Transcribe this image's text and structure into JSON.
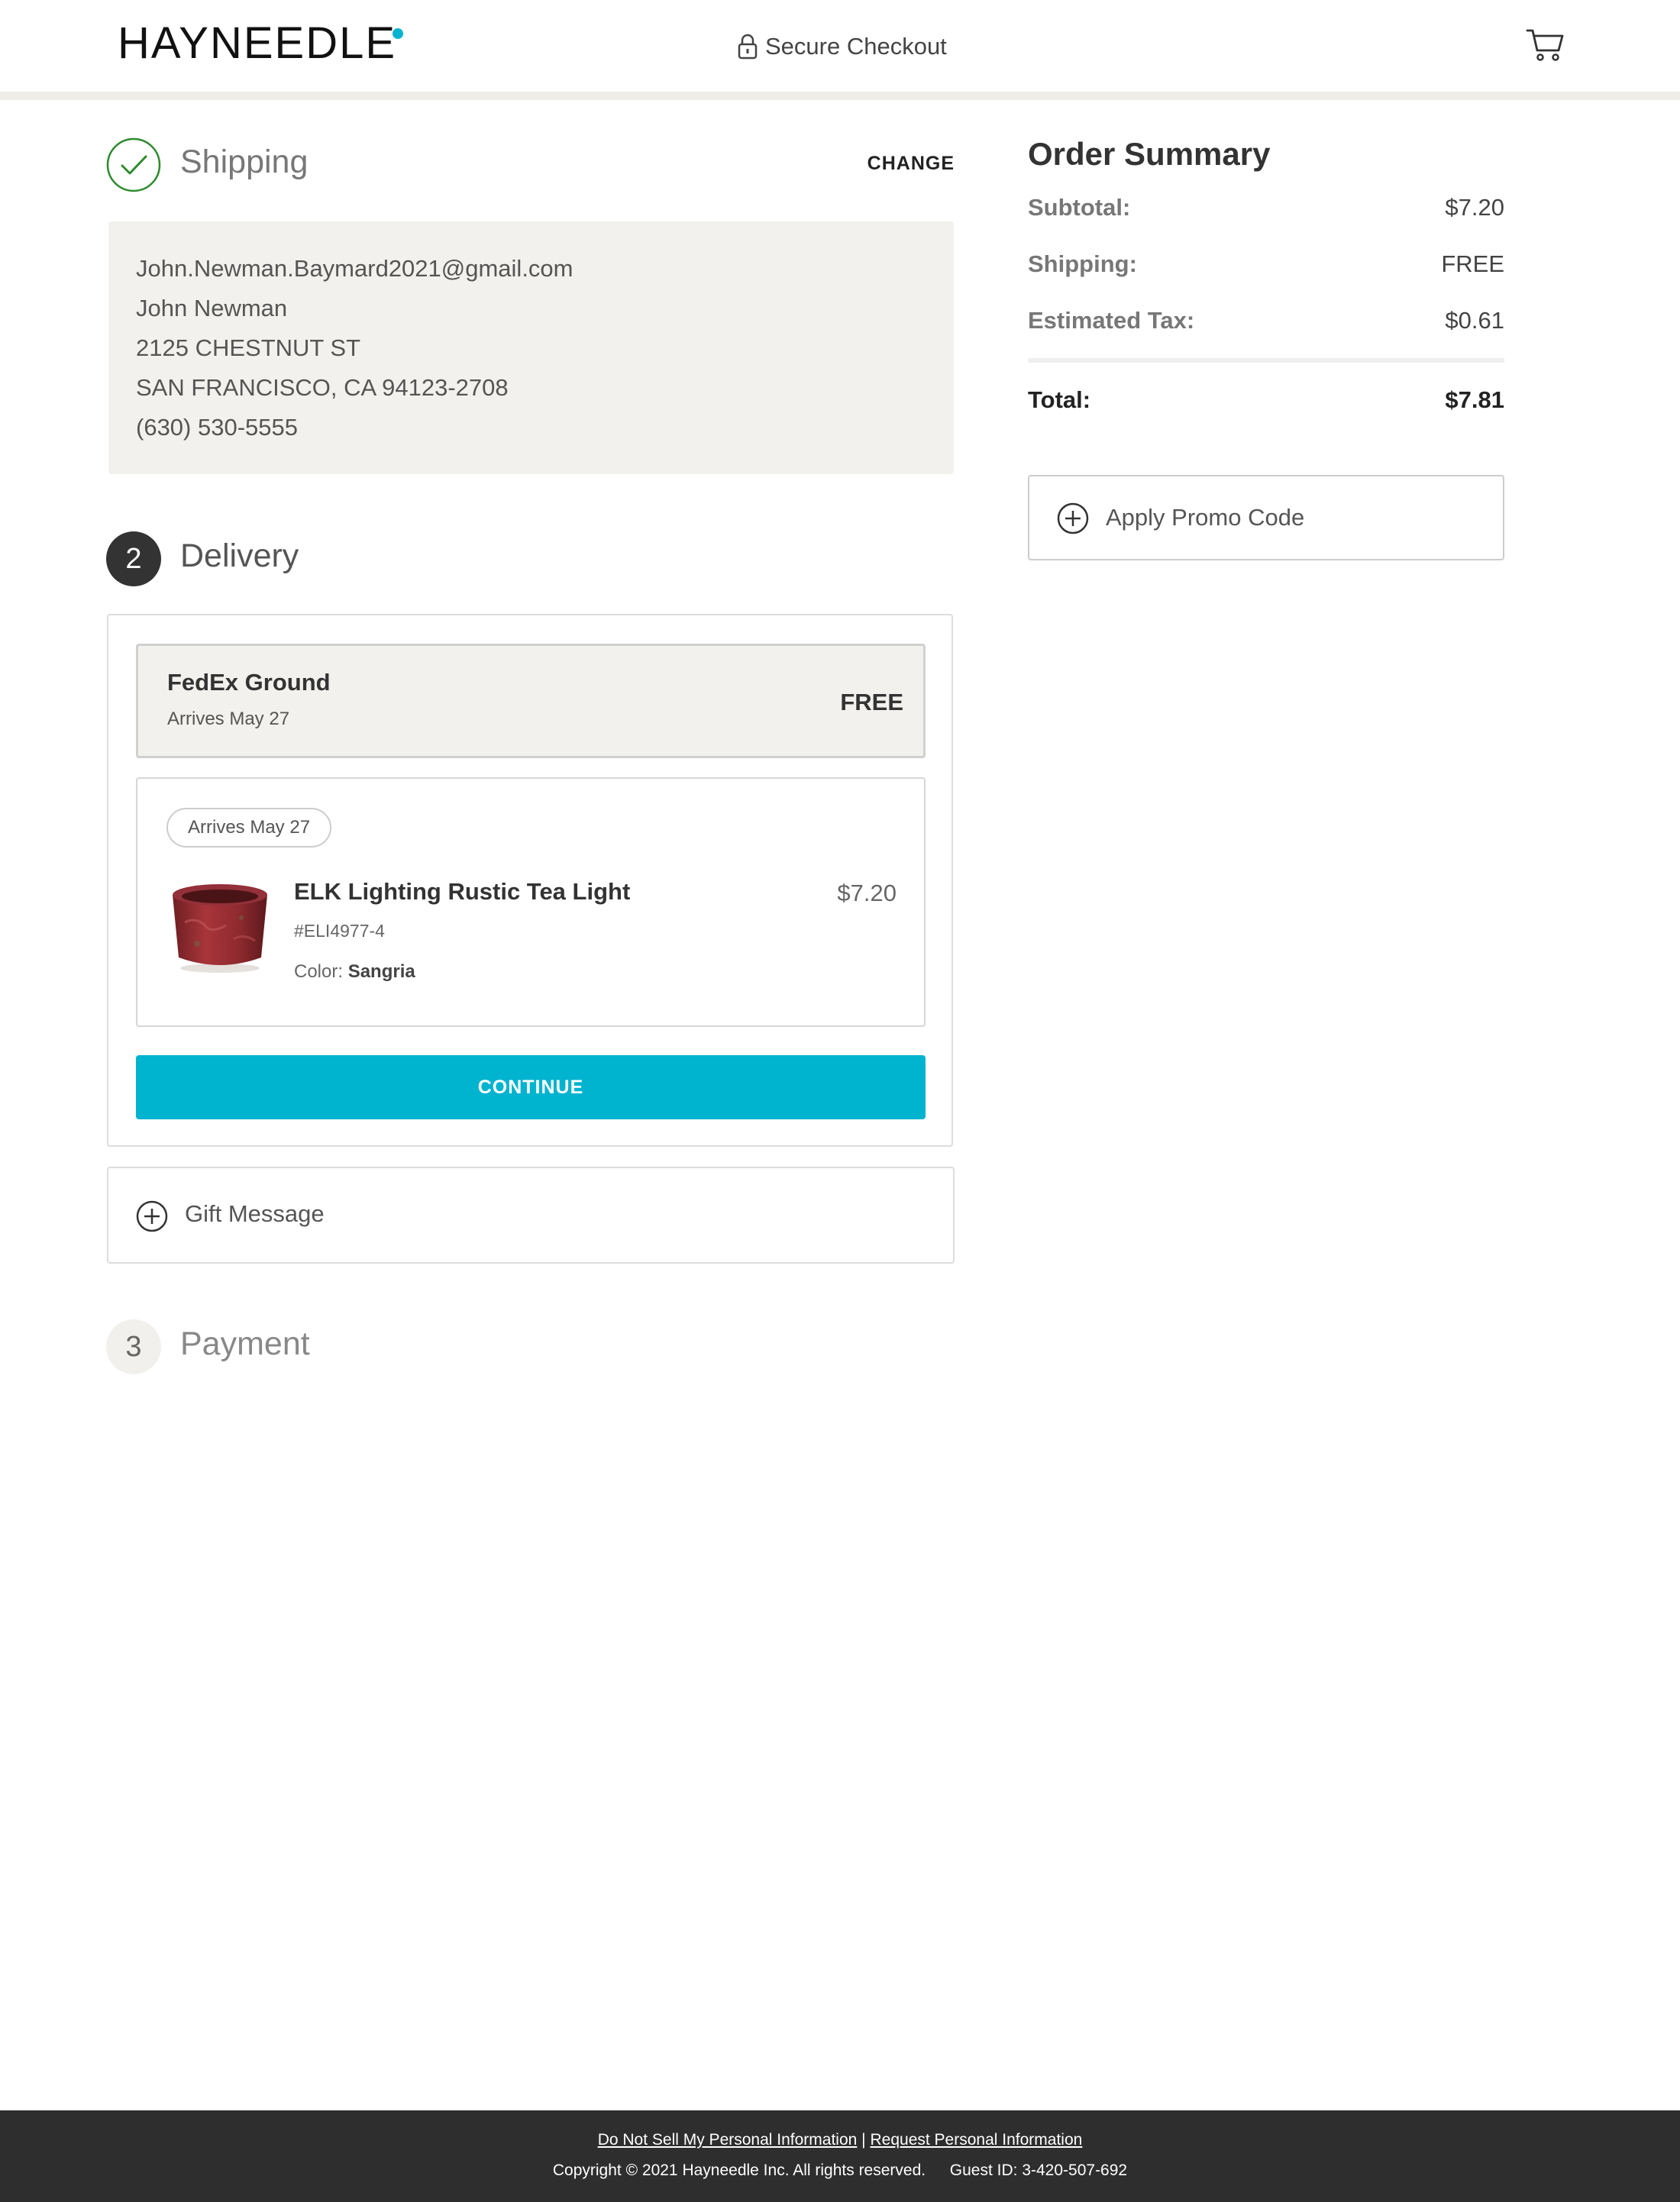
{
  "header": {
    "logo_text": "HAYNEEDLE",
    "secure_checkout": "Secure Checkout",
    "icons": [
      "lock-icon",
      "cart-icon"
    ]
  },
  "shipping": {
    "title": "Shipping",
    "change_label": "CHANGE",
    "address_lines": [
      "John.Newman.Baymard2021@gmail.com",
      "John Newman",
      "2125 CHESTNUT ST",
      "SAN FRANCISCO, CA 94123-2708",
      "(630) 530-5555"
    ]
  },
  "delivery": {
    "step_number": "2",
    "title": "Delivery",
    "option": {
      "name": "FedEx Ground",
      "arrives": "Arrives May 27",
      "price": "FREE"
    },
    "item": {
      "arrives_pill": "Arrives May 27",
      "name": "ELK Lighting Rustic Tea Light",
      "sku": "#ELI4977-4",
      "color_label": "Color:",
      "color_value": "Sangria",
      "price": "$7.20"
    },
    "continue_label": "CONTINUE"
  },
  "gift_message": {
    "label": "Gift Message"
  },
  "payment": {
    "step_number": "3",
    "title": "Payment"
  },
  "order_summary": {
    "title": "Order Summary",
    "subtotal_label": "Subtotal:",
    "subtotal_value": "$7.20",
    "shipping_label": "Shipping:",
    "shipping_value": "FREE",
    "tax_label": "Estimated Tax:",
    "tax_value": "$0.61",
    "total_label": "Total:",
    "total_value": "$7.81",
    "promo_label": "Apply Promo Code"
  },
  "footer": {
    "link_do_not_sell": "Do Not Sell My Personal Information",
    "separator": "|",
    "link_request_info": "Request Personal Information",
    "copyright": "Copyright © 2021 Hayneedle Inc. All rights reserved.",
    "guest_id": "Guest ID: 3-420-507-692"
  },
  "colors": {
    "accent": "#00b3cf",
    "success_green": "#2e8b2e",
    "footer_bg": "#2e2e2e",
    "panel_bg": "#f2f1ed"
  }
}
